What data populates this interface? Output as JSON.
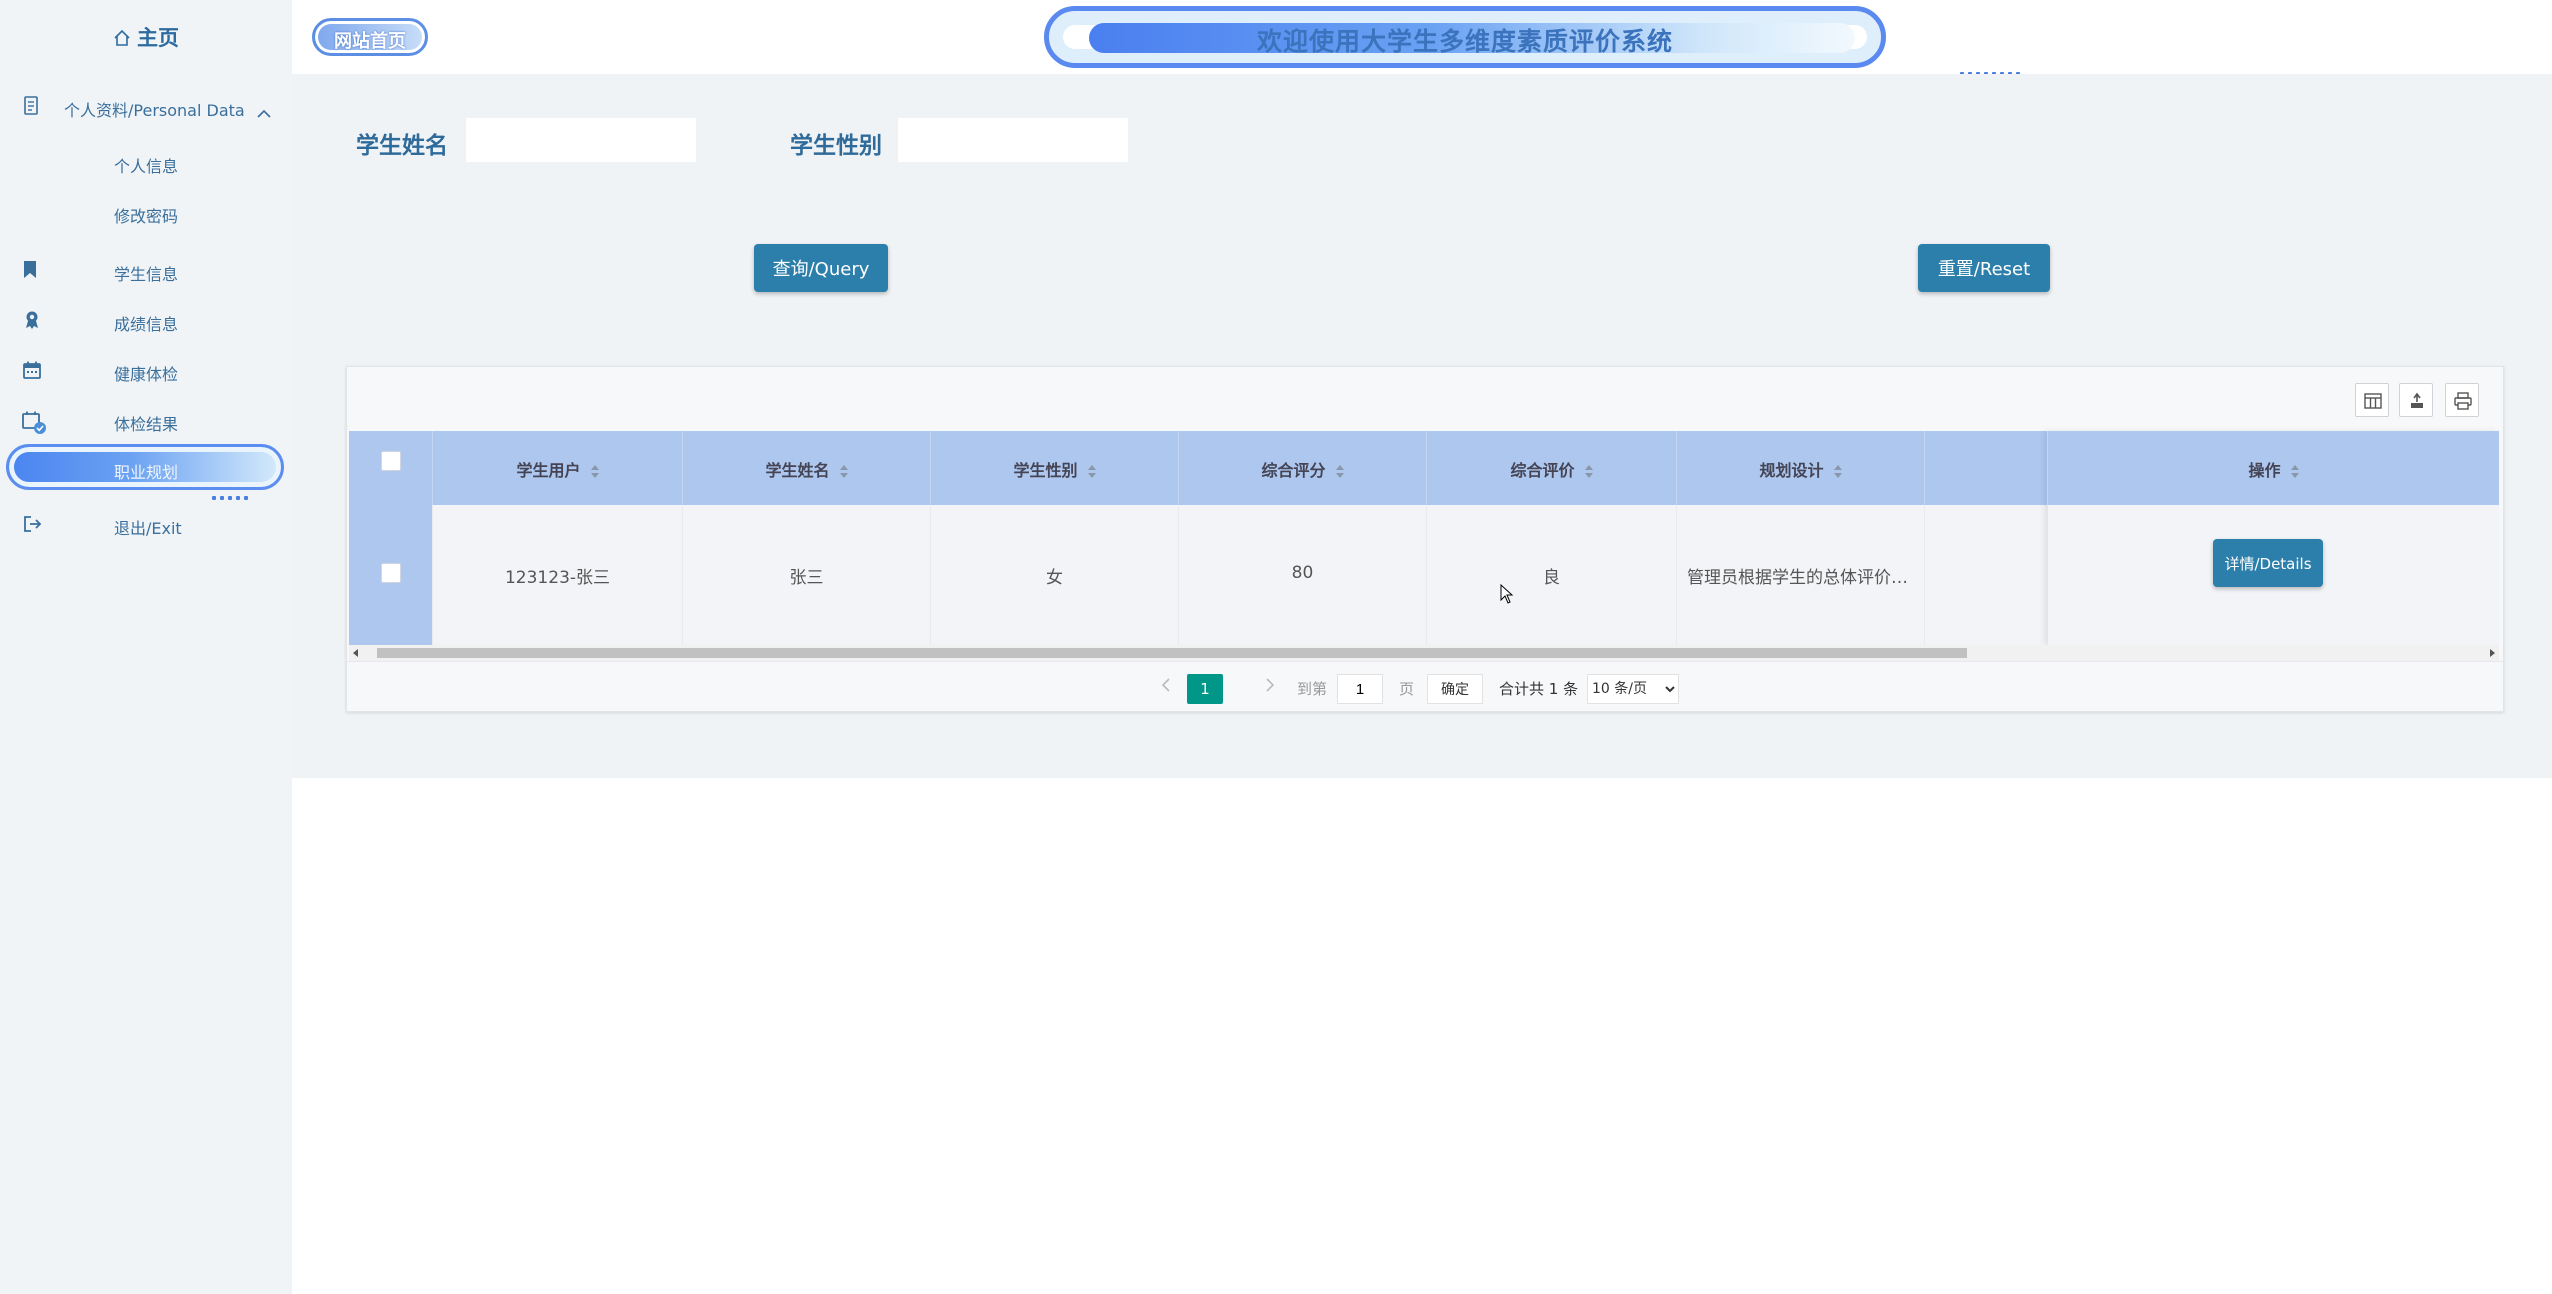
{
  "sidebar": {
    "home_label": "主页",
    "personal_data_label": "个人资料/Personal Data",
    "personal_info_label": "个人信息",
    "change_password_label": "修改密码",
    "student_info_label": "学生信息",
    "grades_label": "成绩信息",
    "health_check_label": "健康体检",
    "exam_results_label": "体检结果",
    "career_planning_label": "职业规划",
    "exit_label": "退出/Exit"
  },
  "topbar": {
    "home_badge": "网站首页",
    "title": "欢迎使用大学生多维度素质评价系统"
  },
  "search": {
    "name_label": "学生姓名",
    "name_value": "",
    "gender_label": "学生性别",
    "gender_value": "",
    "query_button": "查询/Query",
    "reset_button": "重置/Reset"
  },
  "table": {
    "columns": [
      "学生用户",
      "学生姓名",
      "学生性别",
      "综合评分",
      "综合评价",
      "规划设计",
      "",
      "操作"
    ],
    "rows": [
      {
        "user": "123123-张三",
        "name": "张三",
        "gender": "女",
        "score": "80",
        "evaluation": "良",
        "plan": "管理员根据学生的总体评价给予规划设计",
        "details_button": "详情/Details"
      }
    ]
  },
  "pager": {
    "current_page": "1",
    "goto_label": "到第",
    "goto_value": "1",
    "page_unit": "页",
    "confirm": "确定",
    "total_text": "合计共 1 条",
    "page_size": "10 条/页"
  },
  "colors": {
    "sidebar_bg": "#f0f4f7",
    "main_bg": "#f0f3f6",
    "header_bg": "#aec7ee",
    "button": "#2c7fab",
    "page_active": "#009688"
  }
}
